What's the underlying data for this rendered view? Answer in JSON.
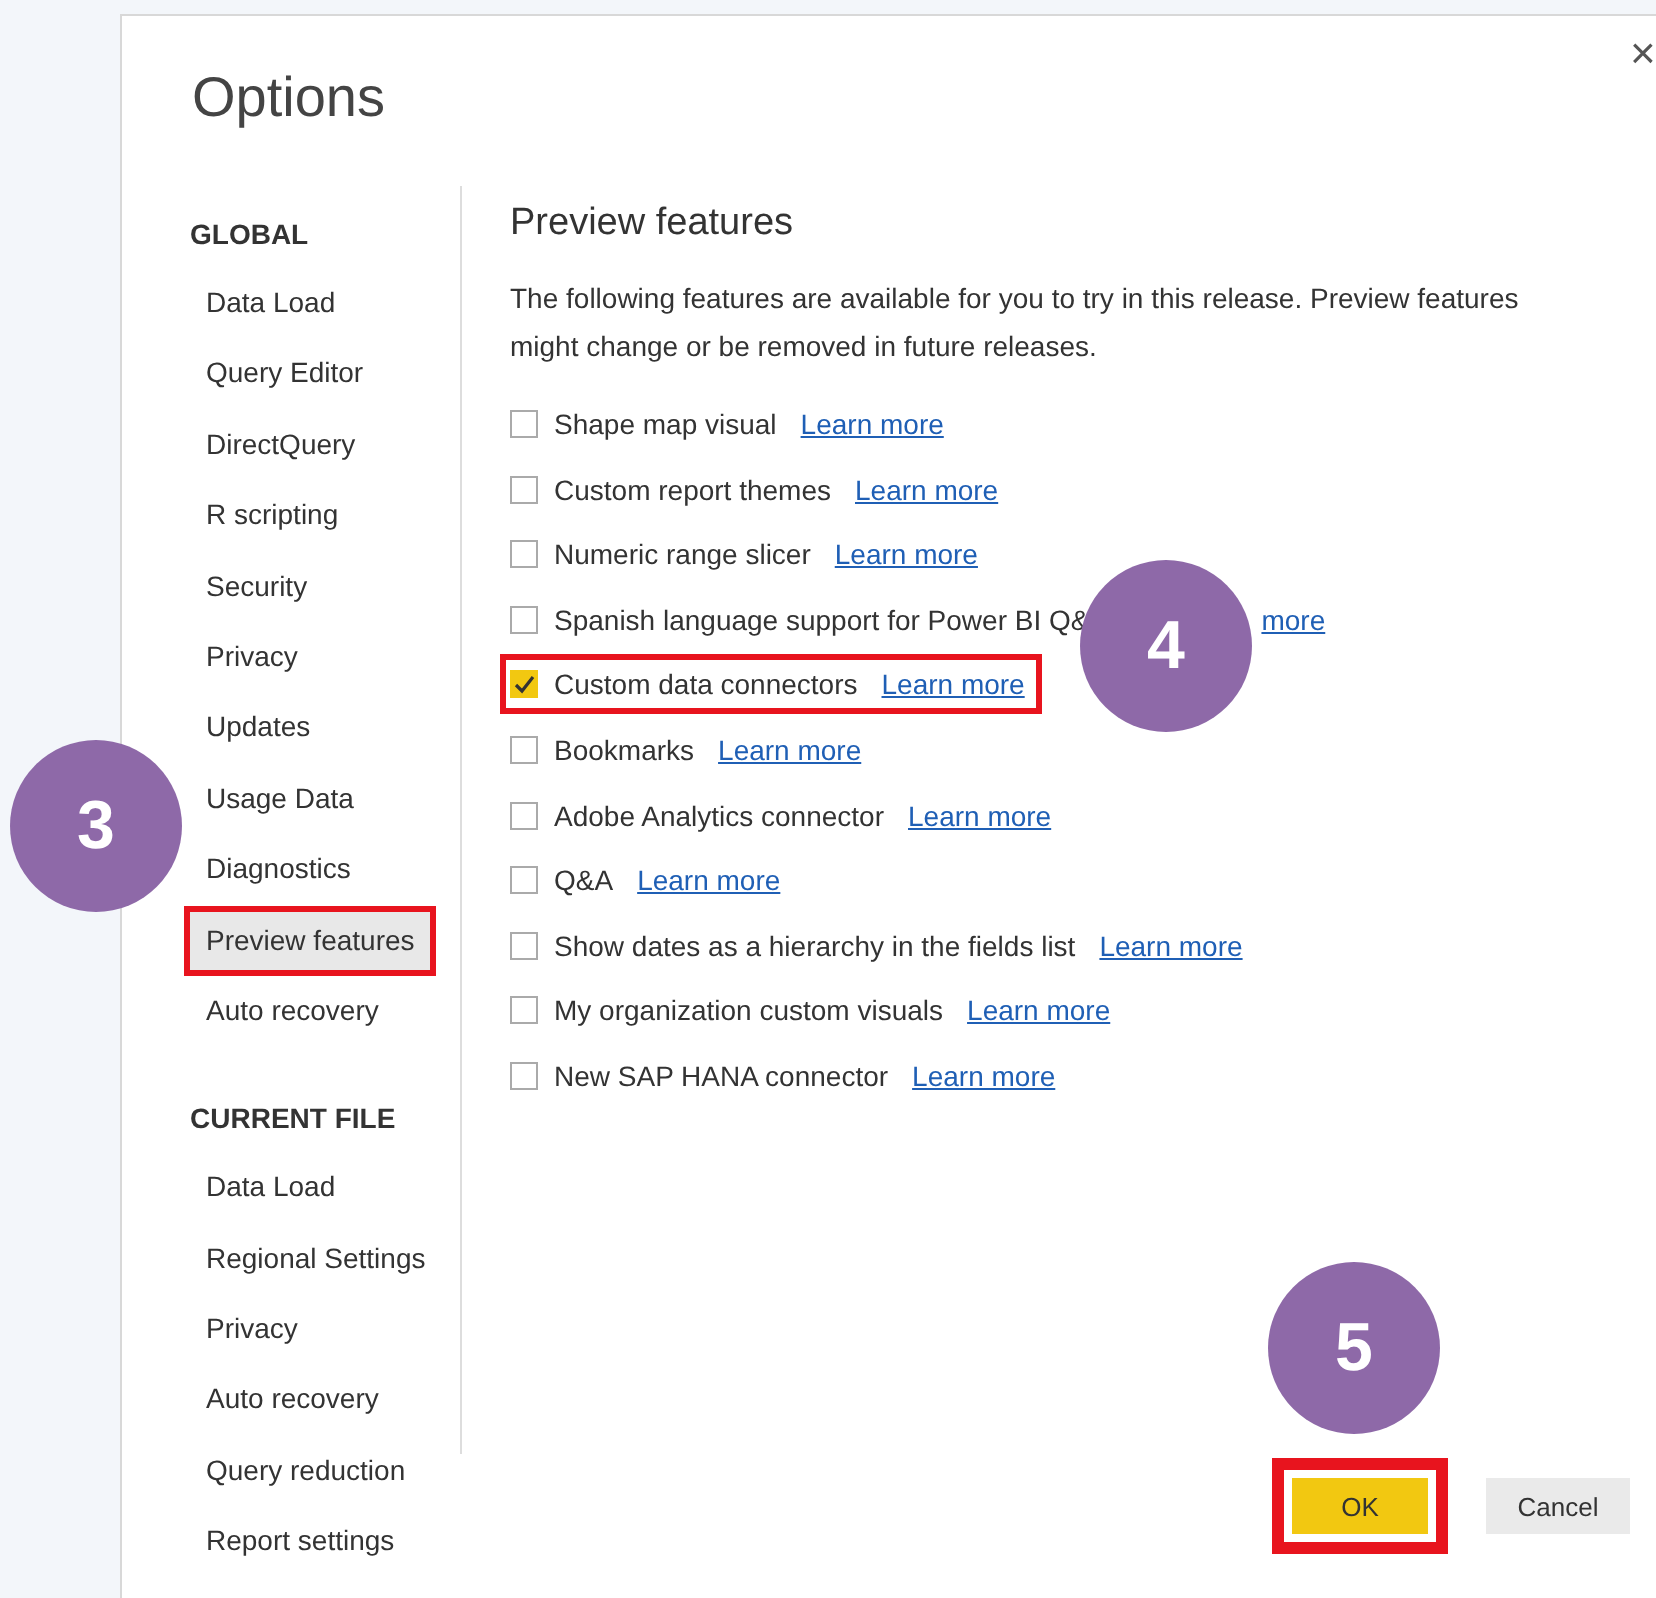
{
  "window": {
    "title": "Options",
    "close": "×"
  },
  "sidebar": {
    "sections": [
      {
        "heading": "GLOBAL",
        "items": [
          {
            "label": "Data Load",
            "selected": false,
            "highlighted": false
          },
          {
            "label": "Query Editor",
            "selected": false,
            "highlighted": false
          },
          {
            "label": "DirectQuery",
            "selected": false,
            "highlighted": false
          },
          {
            "label": "R scripting",
            "selected": false,
            "highlighted": false
          },
          {
            "label": "Security",
            "selected": false,
            "highlighted": false
          },
          {
            "label": "Privacy",
            "selected": false,
            "highlighted": false
          },
          {
            "label": "Updates",
            "selected": false,
            "highlighted": false
          },
          {
            "label": "Usage Data",
            "selected": false,
            "highlighted": false
          },
          {
            "label": "Diagnostics",
            "selected": false,
            "highlighted": false
          },
          {
            "label": "Preview features",
            "selected": true,
            "highlighted": true
          },
          {
            "label": "Auto recovery",
            "selected": false,
            "highlighted": false
          }
        ]
      },
      {
        "heading": "CURRENT FILE",
        "items": [
          {
            "label": "Data Load",
            "selected": false,
            "highlighted": false
          },
          {
            "label": "Regional Settings",
            "selected": false,
            "highlighted": false
          },
          {
            "label": "Privacy",
            "selected": false,
            "highlighted": false
          },
          {
            "label": "Auto recovery",
            "selected": false,
            "highlighted": false
          },
          {
            "label": "Query reduction",
            "selected": false,
            "highlighted": false
          },
          {
            "label": "Report settings",
            "selected": false,
            "highlighted": false
          }
        ]
      }
    ]
  },
  "panel": {
    "heading": "Preview features",
    "description": "The following features are available for you to try in this release. Preview features might change or be removed in future releases.",
    "features": [
      {
        "label": "Shape map visual",
        "link": "Learn more",
        "checked": false,
        "highlighted": false
      },
      {
        "label": "Custom report themes",
        "link": "Learn more",
        "checked": false,
        "highlighted": false
      },
      {
        "label": "Numeric range slicer",
        "link": "Learn more",
        "checked": false,
        "highlighted": false
      },
      {
        "label": "Spanish language support for Power BI Q&",
        "link": "more",
        "checked": false,
        "highlighted": false,
        "covered": true
      },
      {
        "label": "Custom data connectors",
        "link": "Learn more",
        "checked": true,
        "highlighted": true
      },
      {
        "label": "Bookmarks",
        "link": "Learn more",
        "checked": false,
        "highlighted": false
      },
      {
        "label": "Adobe Analytics connector",
        "link": "Learn more",
        "checked": false,
        "highlighted": false
      },
      {
        "label": "Q&A",
        "link": "Learn more",
        "checked": false,
        "highlighted": false
      },
      {
        "label": "Show dates as a hierarchy in the fields list",
        "link": "Learn more",
        "checked": false,
        "highlighted": false
      },
      {
        "label": "My organization custom visuals",
        "link": "Learn more",
        "checked": false,
        "highlighted": false
      },
      {
        "label": "New SAP HANA connector",
        "link": "Learn more",
        "checked": false,
        "highlighted": false
      }
    ]
  },
  "buttons": [
    {
      "label": "OK",
      "kind": "primary",
      "highlighted": true
    },
    {
      "label": "Cancel",
      "kind": "secondary",
      "highlighted": false
    }
  ],
  "callouts": [
    {
      "number": "3"
    },
    {
      "number": "4"
    },
    {
      "number": "5"
    }
  ]
}
